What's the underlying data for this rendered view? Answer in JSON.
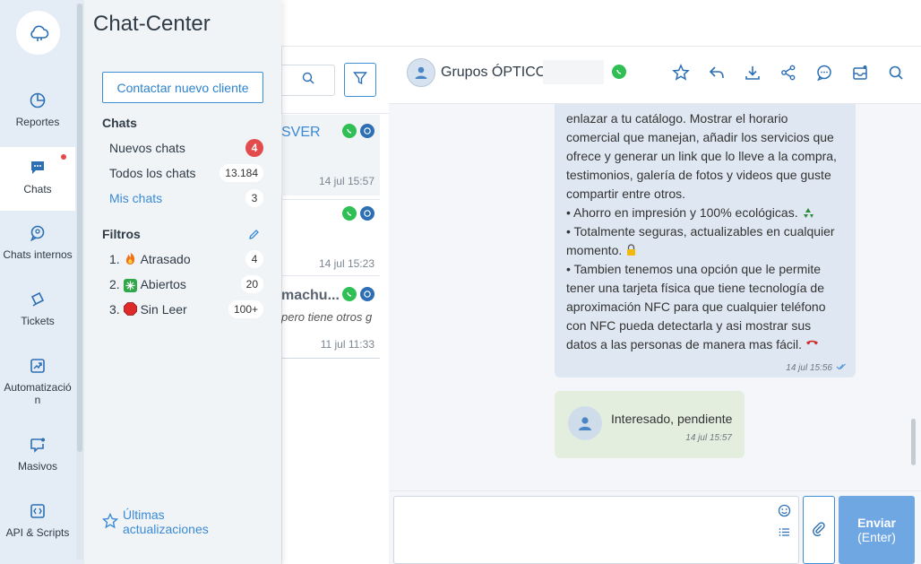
{
  "nav": {
    "items": [
      {
        "label": "Reportes",
        "icon": "chart-pie-icon"
      },
      {
        "label": "Chats",
        "icon": "chat-icon",
        "active": true
      },
      {
        "label": "Chats internos",
        "icon": "internal-chat-icon"
      },
      {
        "label": "Tickets",
        "icon": "ticket-icon"
      },
      {
        "label": "Automatización",
        "icon": "automation-icon"
      },
      {
        "label": "Masivos",
        "icon": "bulk-message-icon"
      },
      {
        "label": "API & Scripts",
        "icon": "code-icon"
      }
    ]
  },
  "chat_center": {
    "title": "Chat-Center",
    "new_client_button": "Contactar nuevo cliente",
    "chats_heading": "Chats",
    "chats": [
      {
        "label": "Nuevos chats",
        "count": "4",
        "highlight": true
      },
      {
        "label": "Todos los chats",
        "count": "13.184"
      },
      {
        "label": "Mis chats",
        "count": "3",
        "active": true
      }
    ],
    "filters_heading": "Filtros",
    "filters": [
      {
        "num": "1.",
        "label": "Atrasado",
        "count": "4",
        "emoji": "fire"
      },
      {
        "num": "2.",
        "label": "Abiertos",
        "count": "20",
        "emoji": "sparkle"
      },
      {
        "num": "3.",
        "label": "Sin Leer",
        "count": "100+",
        "emoji": "stop-sign"
      }
    ],
    "updates_link": "Últimas actualizaciones"
  },
  "chat_list": {
    "items": [
      {
        "name": "SVER",
        "preview": "",
        "time": "14 jul 15:57"
      },
      {
        "name": "",
        "preview": "",
        "time": "14 jul 15:23"
      },
      {
        "name": "machu...",
        "preview": "pero tiene otros g",
        "time": "11 jul 11:33"
      }
    ]
  },
  "conversation": {
    "name": "Grupos ÓPTICO",
    "message1": {
      "lines": [
        "enlazar a tu catálogo. Mostrar el horario comercial que manejan, añadir los servicios que ofrece y generar un link que lo lleve a la compra, testimonios, galería de fotos y videos que guste compartir entre otros.",
        "•  Ahorro en impresión y 100% ecológicas.",
        "•  Totalmente seguras, actualizables en cualquier momento.",
        "•  Tambien tenemos una opción que le permite tener una tarjeta física que tiene tecnología de aproximación NFC para que cualquier teléfono con NFC pueda detectarla y asi mostrar sus datos a las personas de manera mas fácil."
      ],
      "time": "14 jul 15:56"
    },
    "message2": {
      "text": "Interesado, pendiente",
      "time": "14 jul 15:57"
    }
  },
  "composer": {
    "placeholder": "",
    "send_label": "Enviar",
    "send_hint": "(Enter)"
  },
  "colors": {
    "accent": "#3d8fd6",
    "nav_bg": "#e4edf6",
    "badge_red": "#e24c4c",
    "whatsapp": "#2fbf55",
    "send_bg": "#6fa7e3"
  }
}
